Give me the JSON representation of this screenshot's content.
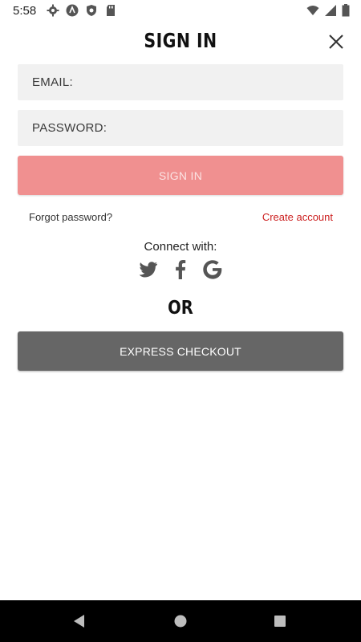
{
  "status_bar": {
    "time": "5:58",
    "left_icons": [
      "settings-icon",
      "app-icon",
      "shield-icon",
      "sd-card-icon"
    ],
    "right_icons": [
      "wifi-icon",
      "signal-icon",
      "battery-icon"
    ]
  },
  "header": {
    "title": "SIGN IN",
    "close_icon": "close-icon"
  },
  "form": {
    "email_placeholder": "EMAIL:",
    "email_value": "",
    "password_placeholder": "PASSWORD:",
    "password_value": "",
    "signin_label": "SIGN IN"
  },
  "links": {
    "forgot_password": "Forgot password?",
    "create_account": "Create account"
  },
  "social": {
    "label": "Connect with:",
    "icons": [
      "twitter-icon",
      "facebook-icon",
      "google-icon"
    ]
  },
  "divider": {
    "or_label": "OR"
  },
  "express": {
    "label": "EXPRESS CHECKOUT"
  },
  "colors": {
    "signin_button": "#f09090",
    "express_button": "#666666",
    "create_account_link": "#cc1f1f",
    "field_background": "#f1f1f1"
  },
  "nav_bar": {
    "icons": [
      "back-icon",
      "home-icon",
      "recents-icon"
    ]
  }
}
